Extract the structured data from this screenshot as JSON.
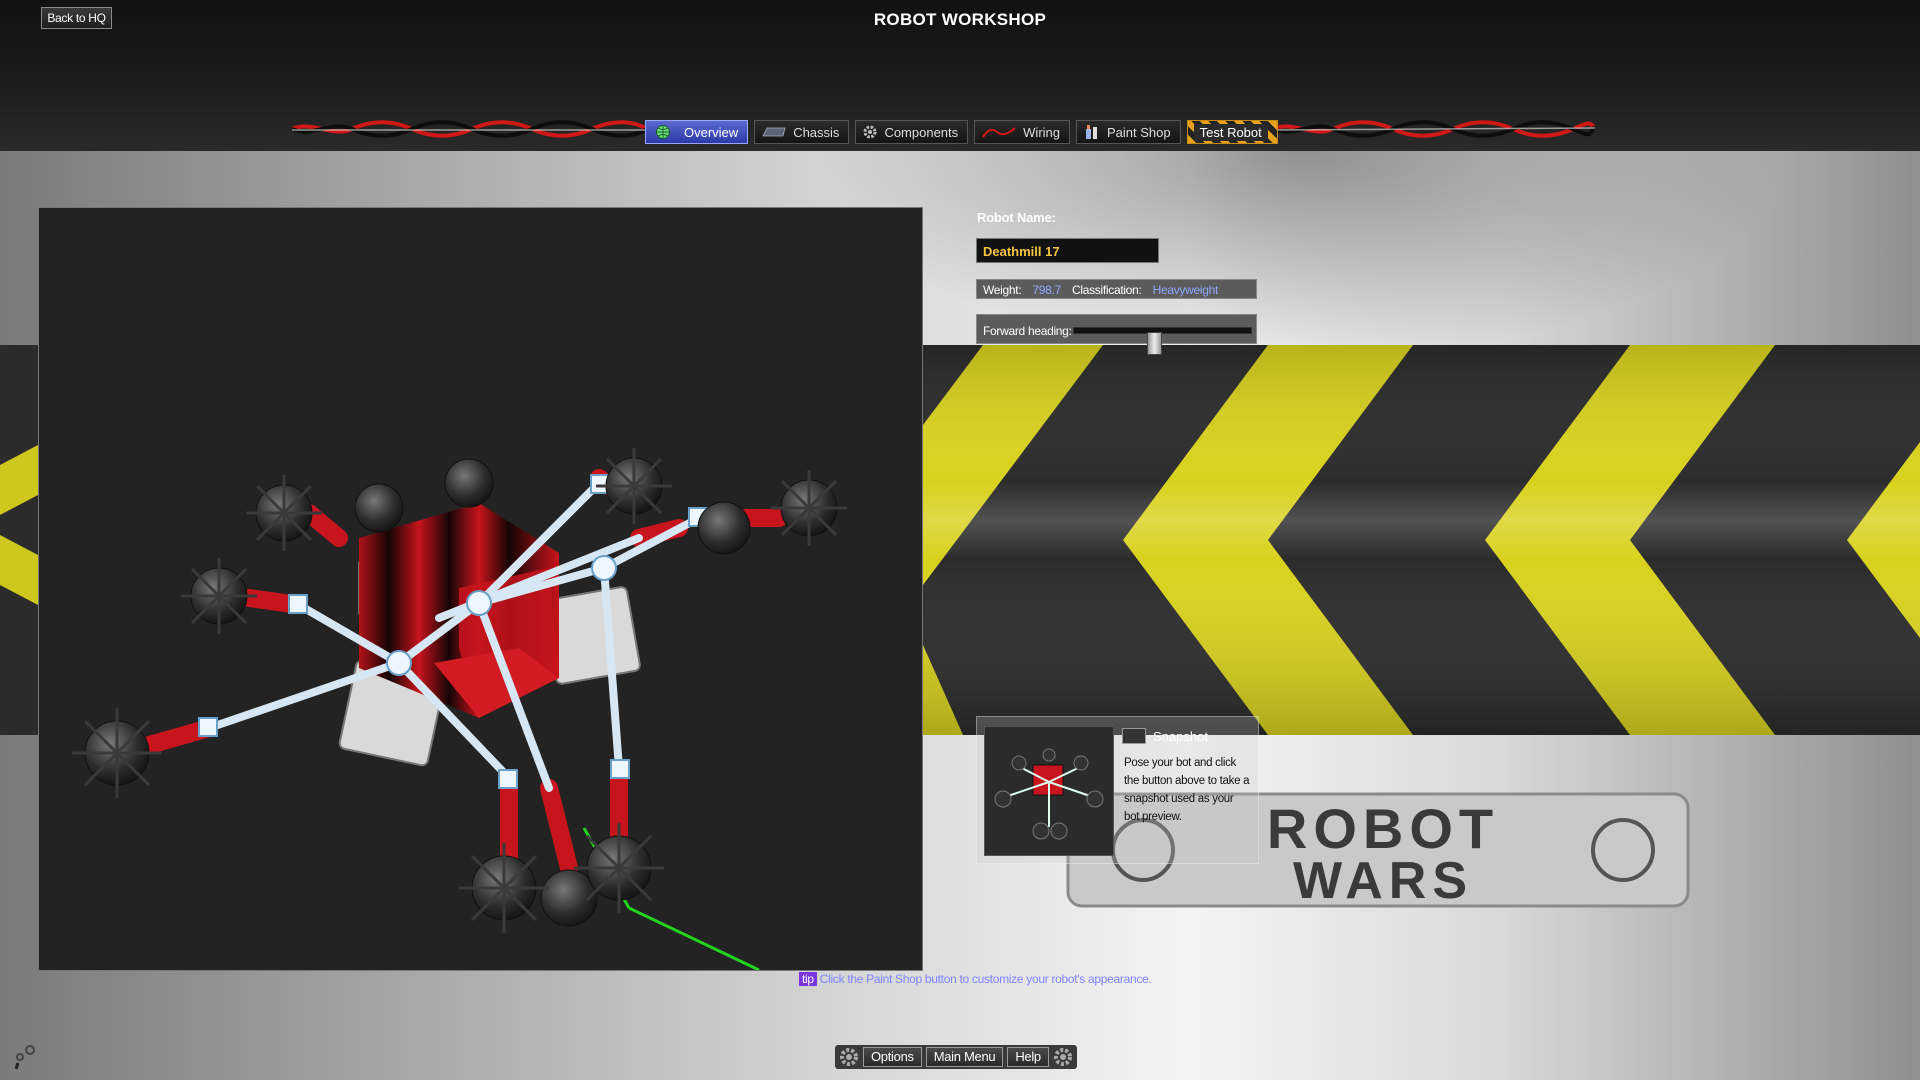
{
  "header": {
    "back_label": "Back to HQ",
    "title": "ROBOT WORKSHOP"
  },
  "tabs": [
    {
      "label": "Overview",
      "icon": "globe-icon",
      "active": true
    },
    {
      "label": "Chassis",
      "icon": "chassis-icon",
      "active": false
    },
    {
      "label": "Components",
      "icon": "gear-icon",
      "active": false
    },
    {
      "label": "Wiring",
      "icon": "wire-icon",
      "active": false
    },
    {
      "label": "Paint Shop",
      "icon": "paint-icon",
      "active": false
    },
    {
      "label": "Test Robot",
      "icon": "hazard",
      "active": false
    }
  ],
  "robot": {
    "name_label": "Robot Name:",
    "name_value": "Deathmill 17",
    "weight_label": "Weight:",
    "weight_value": "798.7",
    "classification_label": "Classification:",
    "classification_value": "Heavyweight",
    "heading_label": "Forward heading:",
    "heading_level": 0.41
  },
  "snapshot": {
    "button_label": "Snapshot",
    "description": "Pose your bot and click the button above to take a snapshot used as your bot preview."
  },
  "logo": {
    "line1": "ROBOT",
    "line2": "WARS"
  },
  "tip": {
    "tag": "tip",
    "text": "Click the Paint Shop button to customize your robot's appearance."
  },
  "bottom": {
    "options_label": "Options",
    "main_menu_label": "Main Menu",
    "help_label": "Help"
  },
  "colors": {
    "accent_tab": "#3f4fc2",
    "name_text": "#f5c542",
    "stat_value": "#8fa8ff",
    "hazard_yellow": "#d8d21e",
    "robot_red": "#c8141c"
  }
}
